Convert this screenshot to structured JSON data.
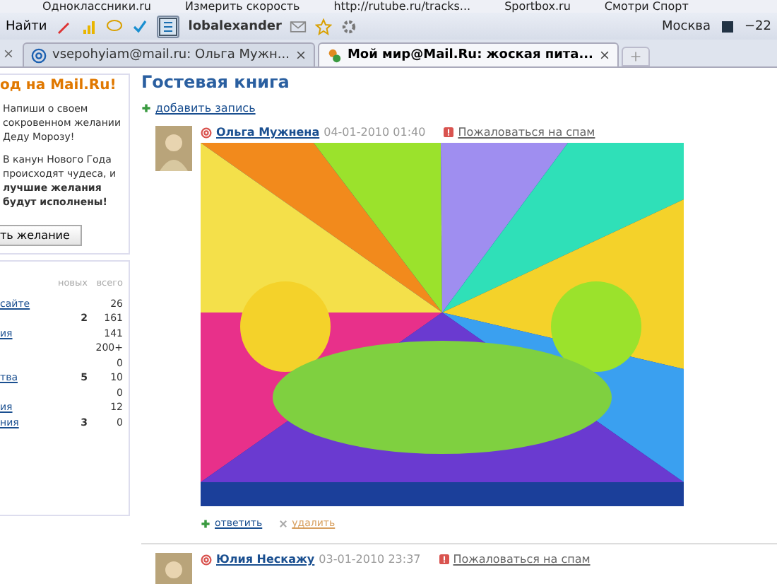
{
  "bookmarks": [
    "Одноклассники.ru",
    "Измерить скорость",
    "http://rutube.ru/tracks...",
    "Sportbox.ru",
    "Смотри Спорт"
  ],
  "toolbar": {
    "search": "Найти",
    "user": "lobalexander",
    "city": "Москва",
    "temperature": "−22"
  },
  "tabs": [
    {
      "label": "vsepohyiam@mail.ru: Ольга Мужн...",
      "selected": false
    },
    {
      "label": "Мой мир@Mail.Ru: жоская пита...",
      "selected": true
    }
  ],
  "promo": {
    "title": "од на Mail.Ru!",
    "text1": "Напиши о своем сокровенном желании Деду Морозу!",
    "text2": "В канун Нового Года происходят чудеса, и **лучшие желания будут исполнены!**",
    "button": "ть желание"
  },
  "stats": {
    "columns": [
      "новых",
      "всего"
    ],
    "rows": [
      {
        "label": "сайте",
        "new": "",
        "total": "26"
      },
      {
        "label": "",
        "new": "2",
        "total": "161"
      },
      {
        "label": "ия",
        "new": "",
        "total": "141"
      },
      {
        "label": "",
        "new": "",
        "total": "200+"
      },
      {
        "label": "",
        "new": "",
        "total": "0"
      },
      {
        "label": "тва",
        "new": "5",
        "total": "10"
      },
      {
        "label": "",
        "new": "",
        "total": "0"
      },
      {
        "label": "ия",
        "new": "",
        "total": "12"
      },
      {
        "label": "ния",
        "new": "3",
        "total": "0"
      }
    ]
  },
  "guestbook": {
    "title": "Гостевая книга",
    "add": "добавить запись",
    "entries": [
      {
        "author": "Ольга Мужнена",
        "date": "04-01-2010 01:40",
        "spam": "Пожаловаться на спам",
        "kind": "picture",
        "reply": "ответить",
        "delete": "удалить"
      },
      {
        "author": "Юлия Нескажу",
        "date": "03-01-2010 23:37",
        "spam": "Пожаловаться на спам"
      }
    ]
  }
}
